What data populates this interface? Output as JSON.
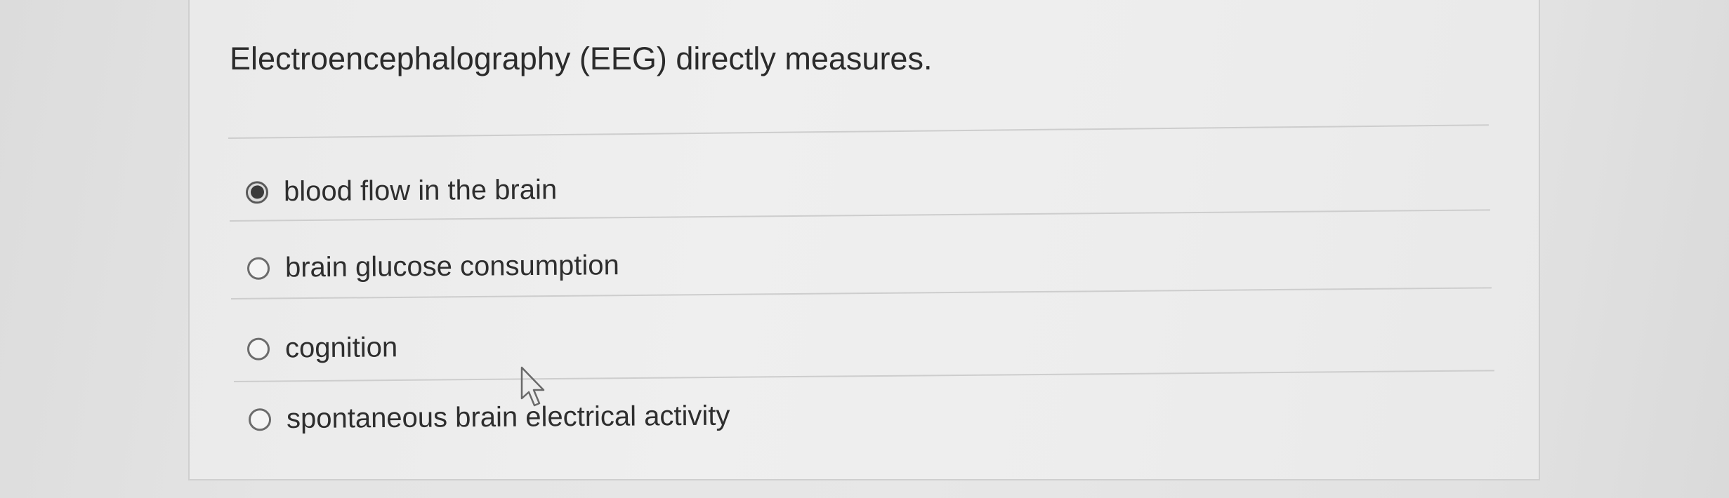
{
  "quiz": {
    "question": "Electroencephalography (EEG) directly measures.",
    "options": [
      {
        "label": "blood flow in the brain",
        "selected": true
      },
      {
        "label": "brain glucose consumption",
        "selected": false
      },
      {
        "label": "cognition",
        "selected": false
      },
      {
        "label": "spontaneous brain electrical activity",
        "selected": false
      }
    ]
  },
  "icons": {
    "cursor": "mouse-pointer-icon",
    "radio": "radio-button-icon"
  },
  "colors": {
    "background": "#e4e4e4",
    "card": "#ededed",
    "text": "#2b2b2b",
    "radio_border": "#6c6c6c",
    "radio_dot": "#3a3a3a"
  }
}
